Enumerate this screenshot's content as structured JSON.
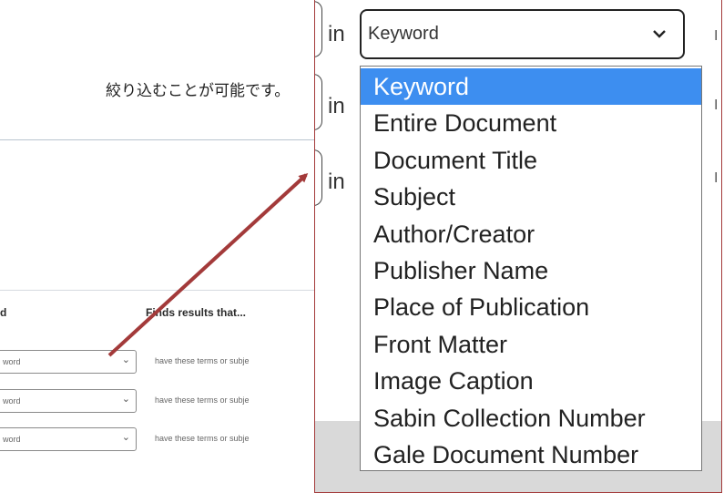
{
  "background_page": {
    "intro_text": "絞り込むことが可能です。",
    "col_header_field": "d",
    "col_header_finds": "Finds results that...",
    "rows": [
      {
        "select_value": "word",
        "hint": "have these terms or subje"
      },
      {
        "select_value": "word",
        "hint": "have these terms or subje"
      },
      {
        "select_value": "word",
        "hint": "have these terms or subje"
      }
    ]
  },
  "zoom": {
    "in_label": "in",
    "right_edge_char": "I",
    "select_value": "Keyword",
    "options": [
      "Keyword",
      "Entire Document",
      "Document Title",
      "Subject",
      "Author/Creator",
      "Publisher Name",
      "Place of Publication",
      "Front Matter",
      "Image Caption",
      "Sabin Collection Number",
      "Gale Document Number"
    ],
    "selected_index": 0
  },
  "icons": {
    "select_chevron": "chevron-down-icon",
    "callout": "arrow-icon"
  },
  "colors": {
    "highlight": "#3d8ef0",
    "callout_arrow": "#a33a3a",
    "panel_border": "#a33a3a"
  }
}
